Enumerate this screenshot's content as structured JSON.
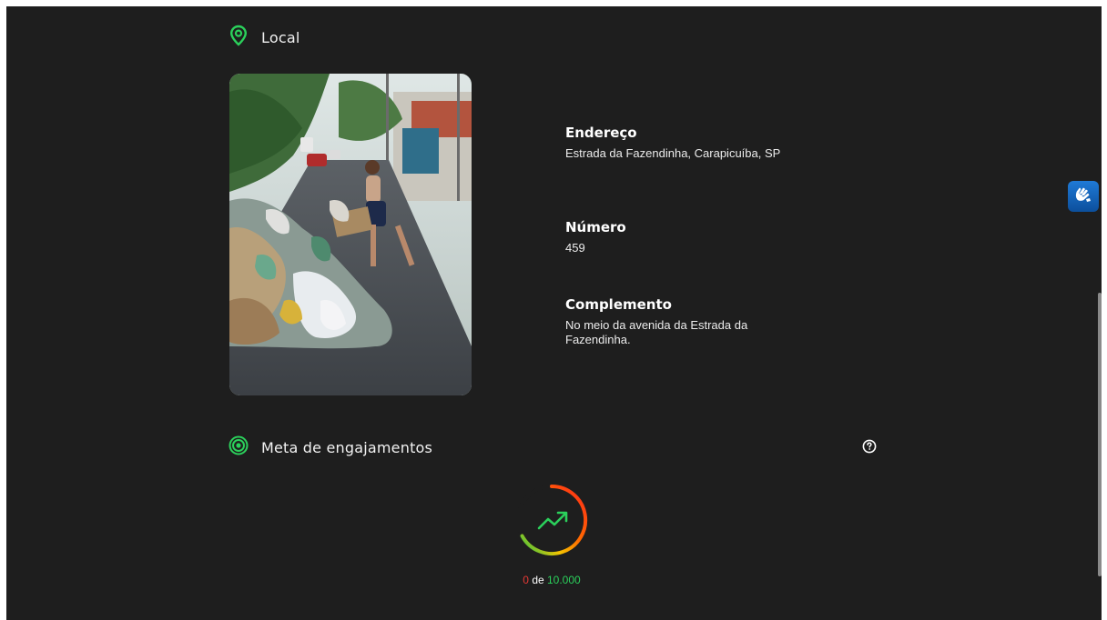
{
  "local": {
    "heading": "Local",
    "icon": "map-pin-icon",
    "photo_alt": "Rua com lixo acumulado",
    "endereco": {
      "title": "Endereço",
      "value": "Estrada da Fazendinha, Carapicuíba, SP"
    },
    "numero": {
      "title": "Número",
      "value": "459"
    },
    "complemento": {
      "title": "Complemento",
      "value": "No meio da avenida da Estrada da Fazendinha."
    }
  },
  "meta": {
    "heading": "Meta de engajamentos",
    "icon": "target-icon",
    "help_icon": "question-circle-icon",
    "progress_icon": "trending-up-icon",
    "current": "0",
    "separator": " de ",
    "goal": "10.000",
    "progress_fraction": 0
  },
  "accessibility": {
    "icon": "sign-language-icon"
  },
  "colors": {
    "background": "#1e1e1e",
    "accent_green": "#2bd05b",
    "accent_red": "#e53935",
    "libras_blue": "#1f7ad6"
  }
}
